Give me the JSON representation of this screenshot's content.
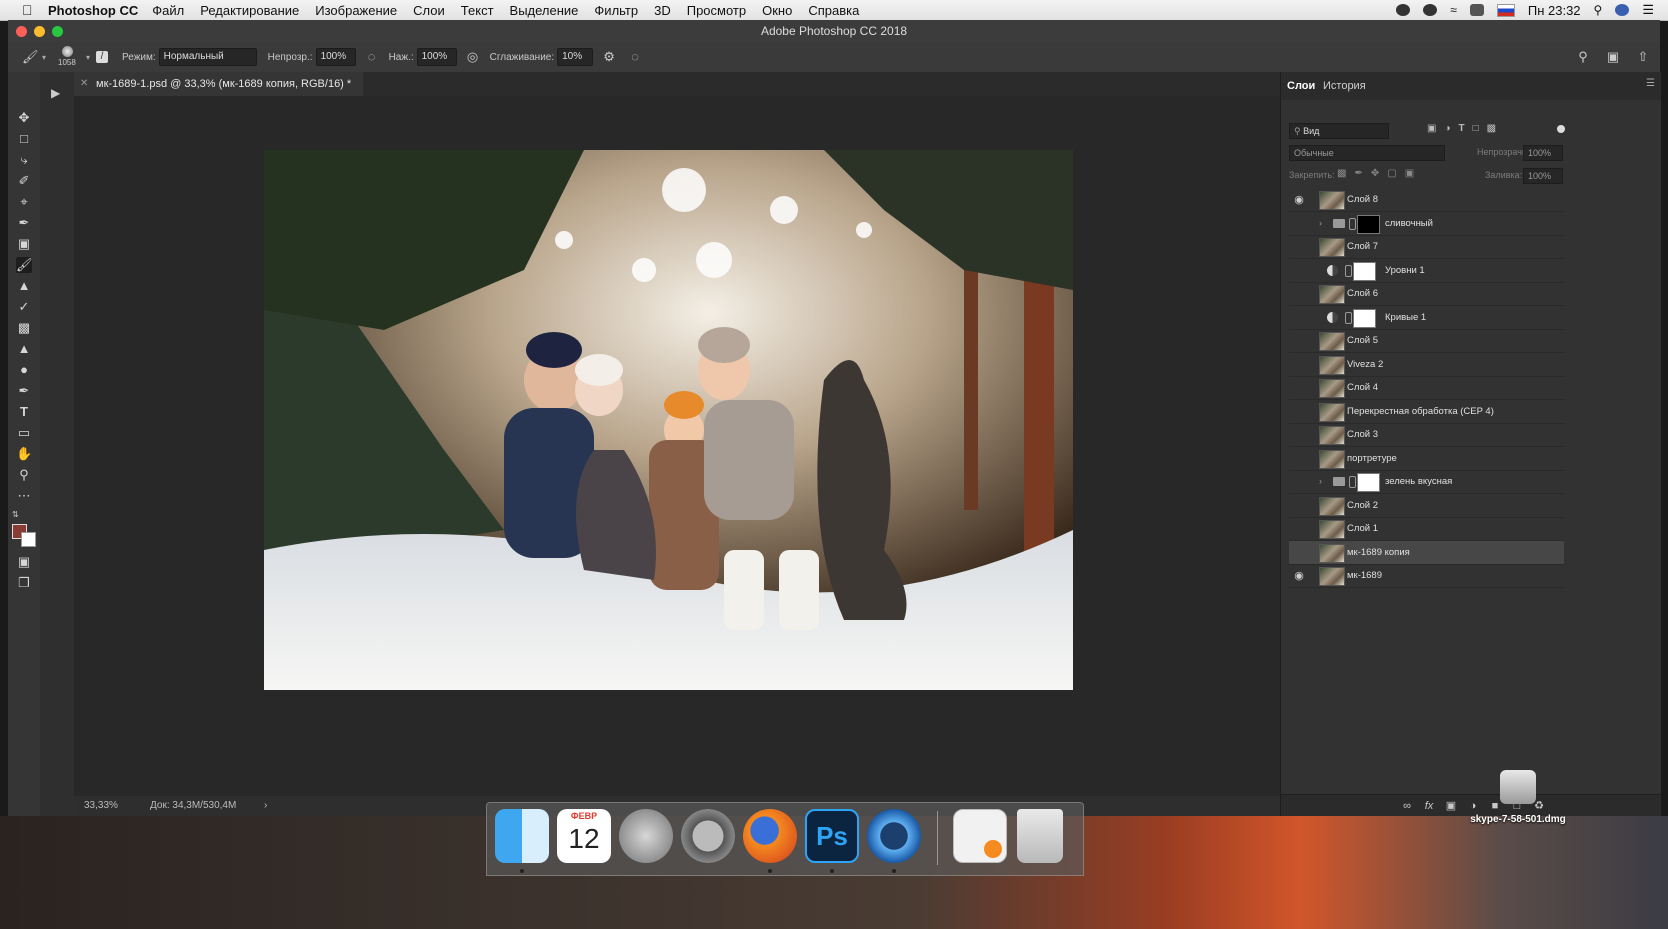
{
  "menubar": {
    "app_name": "Photoshop CC",
    "items": [
      "Файл",
      "Редактирование",
      "Изображение",
      "Слои",
      "Текст",
      "Выделение",
      "Фильтр",
      "3D",
      "Просмотр",
      "Окно",
      "Справка"
    ],
    "clock": "Пн 23:32"
  },
  "window": {
    "title": "Adobe Photoshop CC 2018"
  },
  "options": {
    "brush_size": "1058",
    "mode_label": "Режим:",
    "mode_value": "Нормальный",
    "opacity_label": "Непрозр.:",
    "opacity_value": "100%",
    "pressure_label": "Наж.:",
    "pressure_value": "100%",
    "smoothing_label": "Сглаживание:",
    "smoothing_value": "10%"
  },
  "document": {
    "tab_label": "мк-1689-1.psd @ 33,3% (мк-1689 копия, RGB/16) *",
    "zoom": "33,33%",
    "doc_info": "Док: 34,3M/530,4M"
  },
  "layers_panel": {
    "tabs": [
      "Слои",
      "История"
    ],
    "filter_placeholder": "Вид",
    "blend_mode": "Обычные",
    "opacity_label": "Непрозрачность:",
    "opacity_value": "100%",
    "lock_label": "Закрепить:",
    "fill_label": "Заливка:",
    "fill_value": "100%",
    "layers": [
      {
        "name": "Слой 8",
        "visible": true,
        "kind": "pixel"
      },
      {
        "name": "сливочный",
        "visible": false,
        "kind": "group-mask"
      },
      {
        "name": "Слой 7",
        "visible": false,
        "kind": "pixel"
      },
      {
        "name": "Уровни 1",
        "visible": false,
        "kind": "adjustment"
      },
      {
        "name": "Слой 6",
        "visible": false,
        "kind": "pixel"
      },
      {
        "name": "Кривые 1",
        "visible": false,
        "kind": "adjustment"
      },
      {
        "name": "Слой 5",
        "visible": false,
        "kind": "pixel"
      },
      {
        "name": "Viveza 2",
        "visible": false,
        "kind": "pixel"
      },
      {
        "name": "Слой 4",
        "visible": false,
        "kind": "pixel"
      },
      {
        "name": "Перекрестная обработка (CEP 4)",
        "visible": false,
        "kind": "pixel"
      },
      {
        "name": "Слой 3",
        "visible": false,
        "kind": "pixel"
      },
      {
        "name": "портретуре",
        "visible": false,
        "kind": "pixel"
      },
      {
        "name": "зелень вкусная",
        "visible": false,
        "kind": "group-mask"
      },
      {
        "name": "Слой 2",
        "visible": false,
        "kind": "pixel"
      },
      {
        "name": "Слой 1",
        "visible": false,
        "kind": "pixel"
      },
      {
        "name": "мк-1689 копия",
        "visible": false,
        "kind": "pixel-selected"
      },
      {
        "name": "мк-1689",
        "visible": true,
        "kind": "pixel"
      }
    ]
  },
  "dock": {
    "calendar_month": "ФЕВР",
    "calendar_day": "12",
    "ps_label": "Ps",
    "desktop_file": "skype-7-58-501.dmg"
  }
}
